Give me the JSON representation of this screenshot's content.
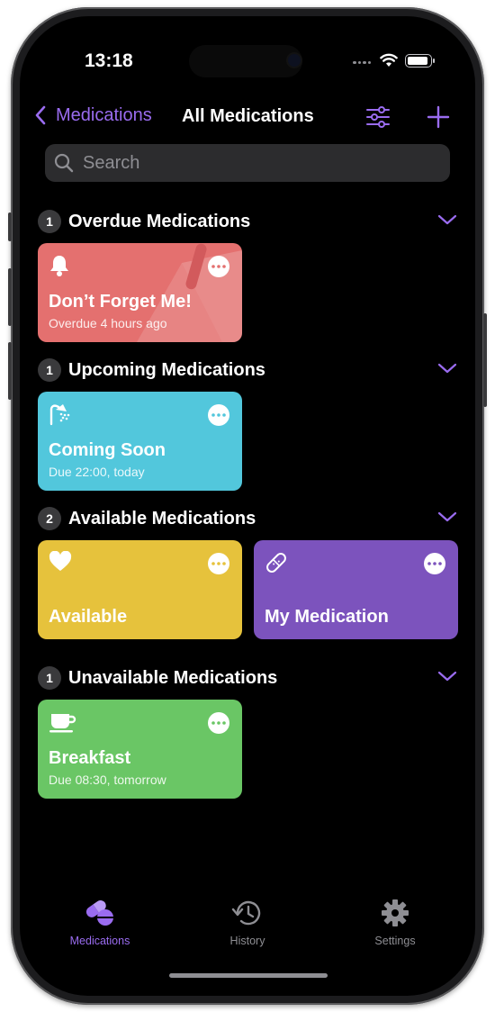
{
  "status": {
    "time": "13:18"
  },
  "nav": {
    "back_label": "Medications",
    "title": "All Medications"
  },
  "search": {
    "placeholder": "Search",
    "value": ""
  },
  "sections": [
    {
      "count": "1",
      "title": "Overdue Medications",
      "cards": [
        {
          "title": "Don’t Forget Me!",
          "subtitle": "Overdue 4 hours ago",
          "color": "#e4706f",
          "icon": "bell-icon"
        }
      ]
    },
    {
      "count": "1",
      "title": "Upcoming Medications",
      "cards": [
        {
          "title": "Coming Soon",
          "subtitle": "Due 22:00, today",
          "color": "#52c7dc",
          "icon": "shower-icon"
        }
      ]
    },
    {
      "count": "2",
      "title": "Available Medications",
      "cards": [
        {
          "title": "Available",
          "subtitle": "",
          "color": "#e6c23c",
          "icon": "heart-icon"
        },
        {
          "title": "My Medication",
          "subtitle": "",
          "color": "#7c53bd",
          "icon": "bandage-icon"
        }
      ]
    },
    {
      "count": "1",
      "title": "Unavailable Medications",
      "cards": [
        {
          "title": "Breakfast",
          "subtitle": "Due 08:30, tomorrow",
          "color": "#6ac665",
          "icon": "cup-icon"
        }
      ]
    }
  ],
  "tabs": [
    {
      "label": "Medications",
      "icon": "pills-icon",
      "selected": true
    },
    {
      "label": "History",
      "icon": "history-icon",
      "selected": false
    },
    {
      "label": "Settings",
      "icon": "gear-icon",
      "selected": false
    }
  ],
  "colors": {
    "accent": "#9a6cf0",
    "tab_inactive": "#8e8e93",
    "background": "#000000"
  }
}
